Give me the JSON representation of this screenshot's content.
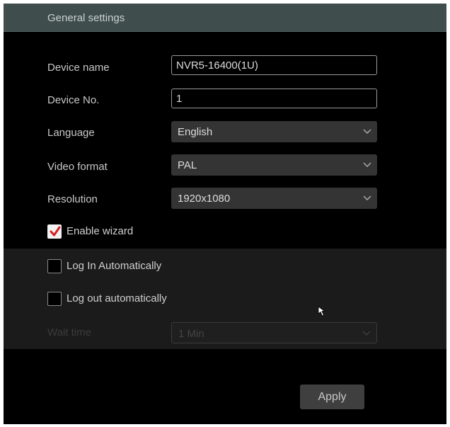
{
  "header": {
    "title": "General settings"
  },
  "fields": {
    "device_name": {
      "label": "Device name",
      "value": "NVR5-16400(1U)"
    },
    "device_no": {
      "label": "Device No.",
      "value": "1"
    },
    "language": {
      "label": "Language",
      "value": "English"
    },
    "video_format": {
      "label": "Video format",
      "value": "PAL"
    },
    "resolution": {
      "label": "Resolution",
      "value": "1920x1080"
    },
    "wait_time": {
      "label": "Wait time",
      "value": "1 Min"
    }
  },
  "checkboxes": {
    "enable_wizard": {
      "label": "Enable wizard",
      "checked": true
    },
    "log_in_automatically": {
      "label": "Log In Automatically",
      "checked": false
    },
    "log_out_automatically": {
      "label": "Log out automatically",
      "checked": false
    }
  },
  "actions": {
    "apply_label": "Apply"
  },
  "colors": {
    "header_background": "#3f4d4c",
    "panel_background": "#000000",
    "section_background": "#1b1b1b",
    "checkmark": "#d62020"
  },
  "icons": {
    "dropdown": "chevron-down-icon",
    "checkmark": "checkmark-icon",
    "cursor": "mouse-pointer-icon"
  }
}
